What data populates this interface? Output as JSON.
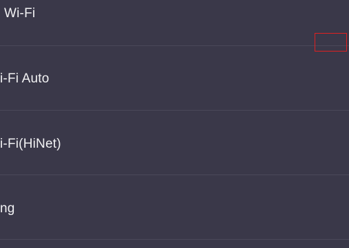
{
  "settings_list": {
    "items": [
      {
        "label": "Wi-Fi"
      },
      {
        "label": "i-Fi Auto"
      },
      {
        "label": "i-Fi(HiNet)"
      },
      {
        "label": "ng"
      }
    ]
  },
  "colors": {
    "background": "#3a3849",
    "text": "#f2f2f4",
    "divider": "#4a4859",
    "highlight": "#e02020"
  }
}
